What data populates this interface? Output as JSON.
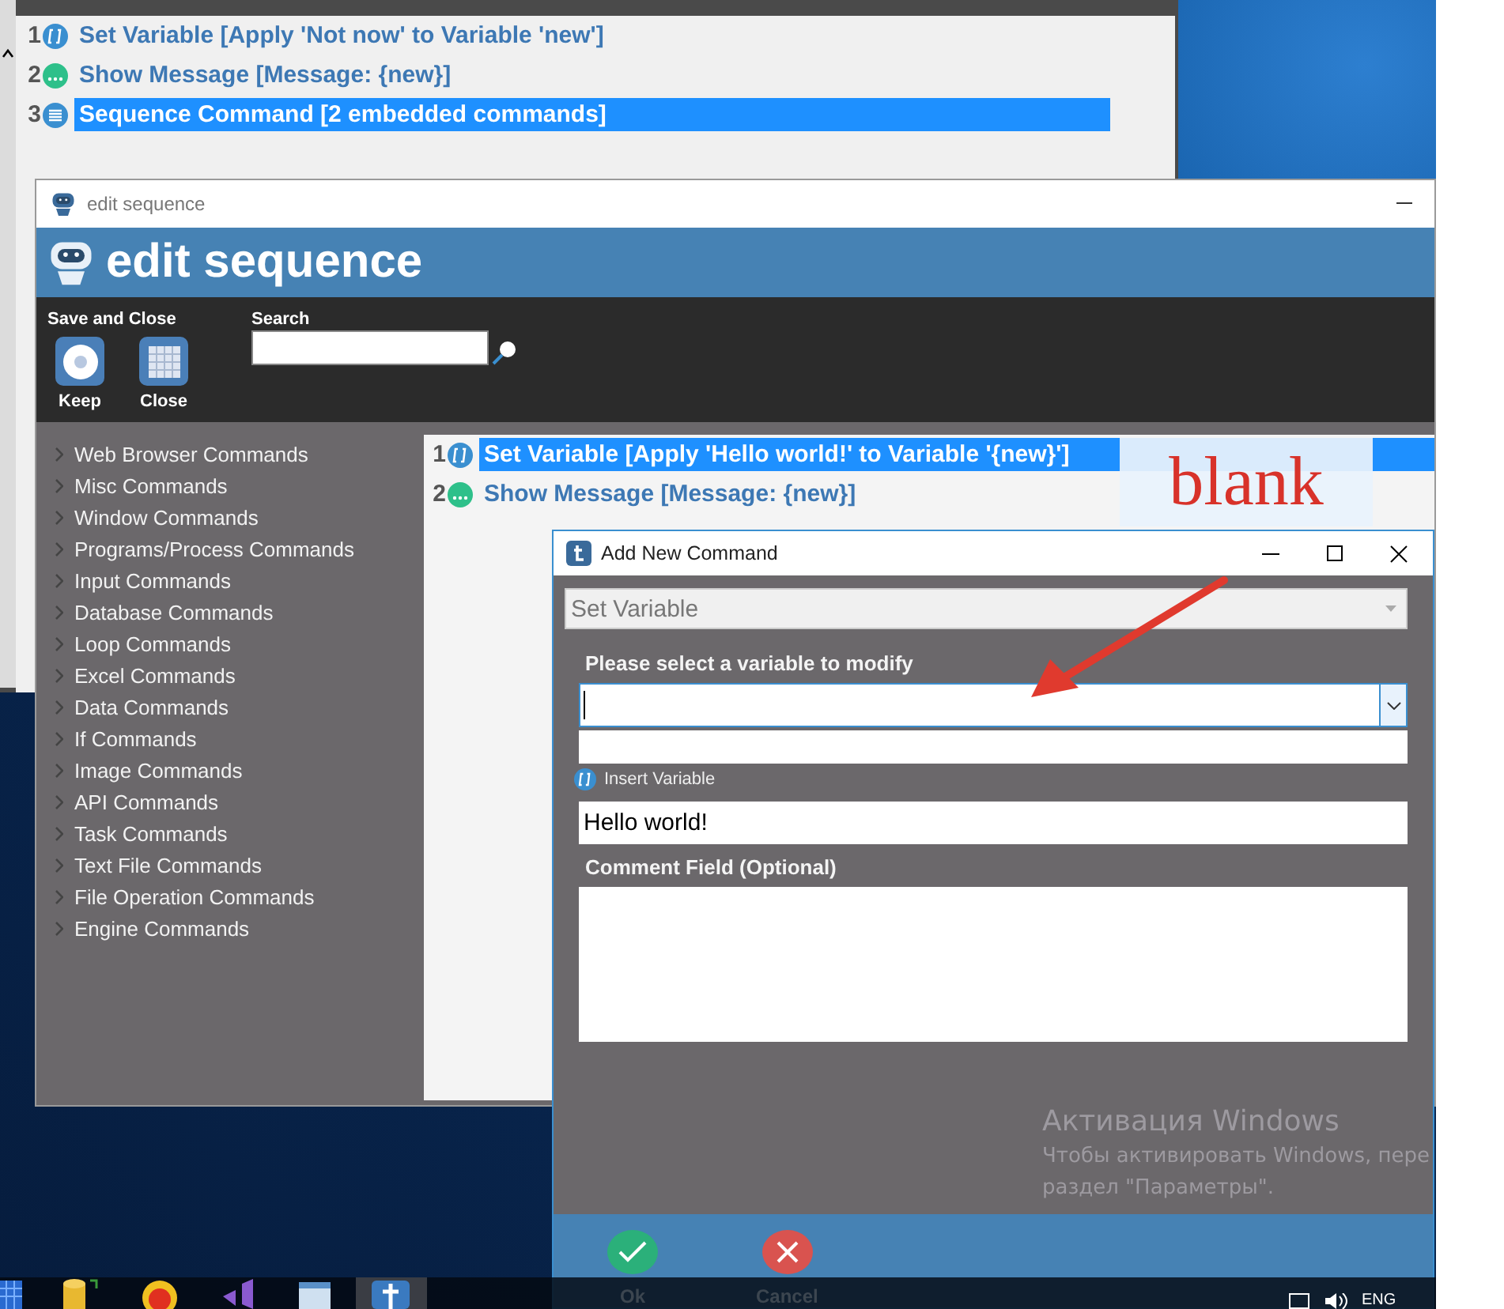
{
  "back_window": {
    "rows": [
      {
        "number": "1",
        "kind": "variable",
        "text": "Set Variable [Apply 'Not now' to Variable 'new']",
        "selected": false
      },
      {
        "number": "2",
        "kind": "message",
        "text": "Show Message [Message: {new}]",
        "selected": false
      },
      {
        "number": "3",
        "kind": "sequence",
        "text": "Sequence Command [2 embedded commands]",
        "selected": true
      }
    ]
  },
  "edit_window": {
    "title": "edit sequence",
    "header": "edit sequence",
    "toolbar": {
      "group_label": "Save and Close",
      "buttons": [
        {
          "kind": "keep",
          "label": "Keep"
        },
        {
          "kind": "close",
          "label": "Close"
        }
      ],
      "search_label": "Search"
    },
    "categories": [
      "Web Browser Commands",
      "Misc Commands",
      "Window Commands",
      "Programs/Process Commands",
      "Input Commands",
      "Database Commands",
      "Loop Commands",
      "Excel Commands",
      "Data Commands",
      "If Commands",
      "Image Commands",
      "API Commands",
      "Task Commands",
      "Text File Commands",
      "File Operation Commands",
      "Engine Commands"
    ],
    "commands": [
      {
        "number": "1",
        "kind": "variable",
        "text": "Set Variable [Apply 'Hello world!' to Variable '{new}']",
        "selected": true
      },
      {
        "number": "2",
        "kind": "message",
        "text": "Show Message [Message: {new}]",
        "selected": false
      }
    ]
  },
  "dialog": {
    "title": "Add New Command",
    "command": "Set Variable",
    "variable_label": "Please select a variable to modify",
    "insert_variable": "Insert Variable",
    "value": "Hello world!",
    "comment_label": "Comment Field (Optional)",
    "buttons": [
      {
        "kind": "ok",
        "label": "Ok"
      },
      {
        "kind": "cancel",
        "label": "Cancel"
      }
    ]
  },
  "annotation": {
    "text": "blank"
  },
  "activation": {
    "title": "Активация Windows",
    "lines": [
      "Чтобы активировать Windows, пере",
      "раздел \"Параметры\"."
    ]
  },
  "taskbar": {
    "language": "ENG"
  }
}
